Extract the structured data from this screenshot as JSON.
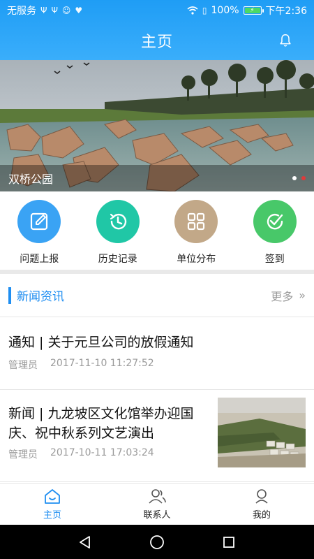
{
  "status_bar": {
    "carrier": "无服务",
    "battery": "100%",
    "time": "下午2:36"
  },
  "header": {
    "title": "主页",
    "bell_icon": "bell-icon"
  },
  "banner": {
    "caption": "双桥公园",
    "slides": 2,
    "active_slide": 1
  },
  "actions": [
    {
      "label": "问题上报",
      "icon": "edit-icon",
      "color": "#3aa3f4"
    },
    {
      "label": "历史记录",
      "icon": "history-icon",
      "color": "#20c7a6"
    },
    {
      "label": "单位分布",
      "icon": "grid-icon",
      "color": "#c2a888"
    },
    {
      "label": "签到",
      "icon": "check-circle-icon",
      "color": "#48c869"
    }
  ],
  "news": {
    "section_title": "新闻资讯",
    "more_label": "更多",
    "items": [
      {
        "headline": "通知 | 关于元旦公司的放假通知",
        "author": "管理员",
        "time": "2017-11-10 11:27:52"
      },
      {
        "headline": "新闻 | 九龙坡区文化馆举办迎国庆、祝中秋系列文艺演出",
        "author": "管理员",
        "time": "2017-10-11 17:03:24"
      }
    ]
  },
  "tabs": [
    {
      "label": "主页",
      "icon": "home-icon",
      "active": true
    },
    {
      "label": "联系人",
      "icon": "contacts-icon",
      "active": false
    },
    {
      "label": "我的",
      "icon": "user-icon",
      "active": false
    }
  ],
  "colors": {
    "primary": "#1f8ef1",
    "header_gradient_top": "#1f9df5",
    "header_gradient_bottom": "#3aaefb"
  }
}
